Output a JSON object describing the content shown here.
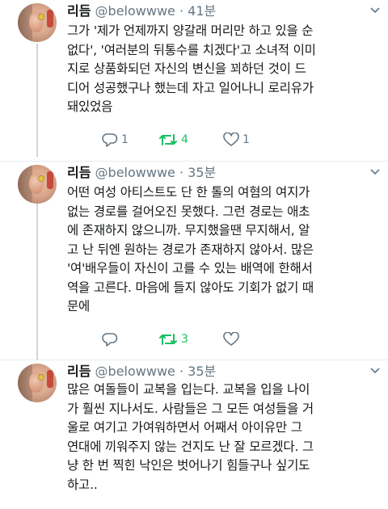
{
  "tweets": [
    {
      "name": "리듬",
      "handle": "@belowwwe",
      "time": "41분",
      "text": "그가 '제가 언제까지 양갈래 머리만 하고 있을 순\n없다', '여러분의 뒤통수를 치겠다'고 소녀적 이미\n지로 상품화되던 자신의 변신을 꾀하던 것이 드\n디어 성공했구나 했는데 자고 일어나니 로리유가\n돼있었음",
      "reply_count": "1",
      "retweet_count": "4",
      "like_count": "1"
    },
    {
      "name": "리듬",
      "handle": "@belowwwe",
      "time": "35분",
      "text": "어떤 여성 아티스트도 단 한 톨의 여혐의 여지가\n없는 경로를 걸어오진 못했다. 그런 경로는 애초\n에 존재하지 않으니까. 무지했을땐 무지해서, 알\n고 난 뒤엔 원하는 경로가 존재하지 않아서. 많은\n'여'배우들이 자신이 고를 수 있는 배역에 한해서\n역을 고른다. 마음에 들지 않아도 기회가 없기 때\n문에",
      "reply_count": "",
      "retweet_count": "3",
      "like_count": ""
    },
    {
      "name": "리듬",
      "handle": "@belowwwe",
      "time": "35분",
      "text": "많은 여돌들이 교복을 입는다. 교복을 입을 나이\n가 훨씬 지나서도. 사람들은 그 모든 여성들을 거\n울로 여기고 가여워하면서 어째서 아이유만 그\n연대에 끼워주지 않는 건지도 난 잘 모르겠다. 그\n냥 한 번 찍힌 낙인은 벗어나기 힘들구나 싶기도\n하고..",
      "reply_count": "",
      "retweet_count": "",
      "like_count": ""
    }
  ],
  "icons": {
    "reply": "reply-icon",
    "retweet": "retweet-icon",
    "like": "heart-icon",
    "more": "chevron-down-icon"
  },
  "colors": {
    "text": "#14171a",
    "secondary": "#657786",
    "retweet_active": "#17bf63",
    "thread_line": "#ccd6dd"
  }
}
